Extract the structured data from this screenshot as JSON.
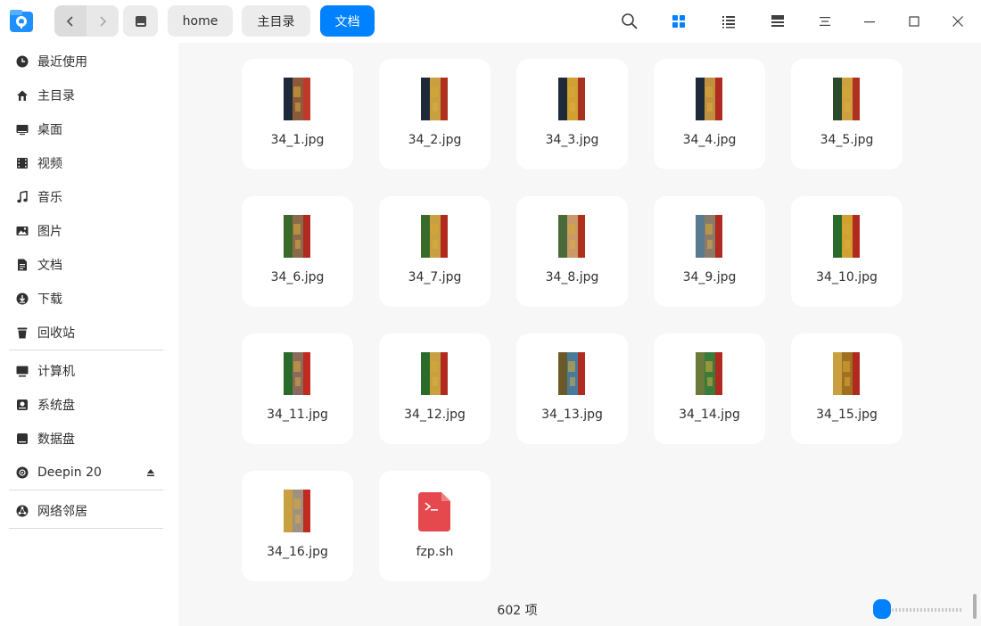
{
  "titlebar": {
    "breadcrumbs": [
      "home",
      "主目录",
      "文档"
    ],
    "icons": [
      "search-icon",
      "icon-view-icon",
      "list-view-icon",
      "detail-view-icon",
      "menu-icon",
      "minimize-icon",
      "maximize-icon",
      "close-icon"
    ]
  },
  "sidebar": {
    "items": [
      {
        "label": "最近使用",
        "icon": "clock-icon"
      },
      {
        "label": "主目录",
        "icon": "home-icon"
      },
      {
        "label": "桌面",
        "icon": "desktop-icon"
      },
      {
        "label": "视频",
        "icon": "video-icon"
      },
      {
        "label": "音乐",
        "icon": "music-icon"
      },
      {
        "label": "图片",
        "icon": "picture-icon"
      },
      {
        "label": "文档",
        "icon": "document-icon"
      },
      {
        "label": "下载",
        "icon": "download-icon"
      },
      {
        "label": "回收站",
        "icon": "trash-icon"
      },
      {
        "label": "计算机",
        "icon": "computer-icon"
      },
      {
        "label": "系统盘",
        "icon": "system-disk-icon"
      },
      {
        "label": "数据盘",
        "icon": "data-disk-icon"
      },
      {
        "label": "Deepin 20",
        "icon": "optical-disc-icon"
      },
      {
        "label": "网络邻居",
        "icon": "network-icon"
      }
    ]
  },
  "files": [
    {
      "name": "34_1.jpg",
      "palette": [
        "#1e2a3a",
        "#8a5a3a",
        "#c0392b"
      ]
    },
    {
      "name": "34_2.jpg",
      "palette": [
        "#1e2a3a",
        "#c8a040",
        "#b03020"
      ]
    },
    {
      "name": "34_3.jpg",
      "palette": [
        "#1e2a3a",
        "#d0a030",
        "#a83222"
      ]
    },
    {
      "name": "34_4.jpg",
      "palette": [
        "#1e2a3a",
        "#c09040",
        "#b02a20"
      ]
    },
    {
      "name": "34_5.jpg",
      "palette": [
        "#2a4a2a",
        "#d0a040",
        "#b03020"
      ]
    },
    {
      "name": "34_6.jpg",
      "palette": [
        "#3a6a2a",
        "#8a6a4a",
        "#b02a20"
      ]
    },
    {
      "name": "34_7.jpg",
      "palette": [
        "#3a6a2a",
        "#c8a040",
        "#b02a20"
      ]
    },
    {
      "name": "34_8.jpg",
      "palette": [
        "#4a6a3a",
        "#c89a6a",
        "#b03020"
      ]
    },
    {
      "name": "34_9.jpg",
      "palette": [
        "#5a7a90",
        "#8a7a6a",
        "#b02a20"
      ]
    },
    {
      "name": "34_10.jpg",
      "palette": [
        "#2a6a2a",
        "#d0a030",
        "#b02a20"
      ]
    },
    {
      "name": "34_11.jpg",
      "palette": [
        "#2a6a2a",
        "#8a6a5a",
        "#c02a20"
      ]
    },
    {
      "name": "34_12.jpg",
      "palette": [
        "#2a6a2a",
        "#c8a040",
        "#b02a20"
      ]
    },
    {
      "name": "34_13.jpg",
      "palette": [
        "#6a5a2a",
        "#4a7a9a",
        "#b02a20"
      ]
    },
    {
      "name": "34_14.jpg",
      "palette": [
        "#6a7a3a",
        "#3a7a3a",
        "#b02a20"
      ]
    },
    {
      "name": "34_15.jpg",
      "palette": [
        "#c8a040",
        "#a07020",
        "#b02a20"
      ]
    },
    {
      "name": "34_16.jpg",
      "palette": [
        "#c8a040",
        "#a09080",
        "#c02a20"
      ]
    },
    {
      "name": "fzp.sh",
      "palette": [
        "#e5484d",
        "#e5484d",
        "#e5484d"
      ]
    }
  ],
  "status": {
    "count_text": "602 项"
  },
  "colors": {
    "accent": "#0081ff",
    "content_bg": "#f7f7f7"
  }
}
